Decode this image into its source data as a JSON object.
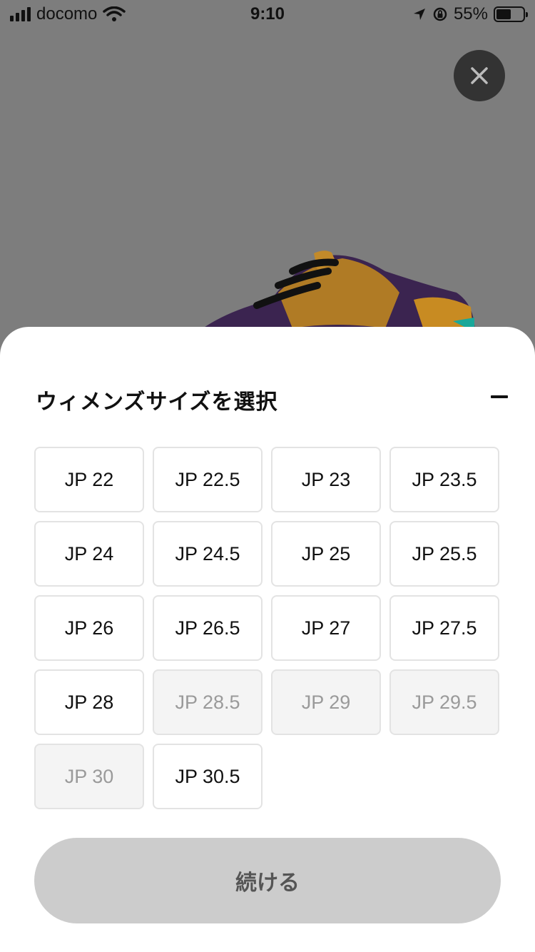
{
  "status_bar": {
    "carrier": "docomo",
    "time": "9:10",
    "battery": "55%",
    "battery_level": 0.55
  },
  "close": {
    "icon": "close-icon"
  },
  "sheet": {
    "title": "ウィメンズサイズを選択",
    "collapse_icon": "minus-icon",
    "sizes": [
      {
        "label": "JP 22",
        "available": true
      },
      {
        "label": "JP 22.5",
        "available": true
      },
      {
        "label": "JP 23",
        "available": true
      },
      {
        "label": "JP 23.5",
        "available": true
      },
      {
        "label": "JP 24",
        "available": true
      },
      {
        "label": "JP 24.5",
        "available": true
      },
      {
        "label": "JP 25",
        "available": true
      },
      {
        "label": "JP 25.5",
        "available": true
      },
      {
        "label": "JP 26",
        "available": true
      },
      {
        "label": "JP 26.5",
        "available": true
      },
      {
        "label": "JP 27",
        "available": true
      },
      {
        "label": "JP 27.5",
        "available": true
      },
      {
        "label": "JP 28",
        "available": true
      },
      {
        "label": "JP 28.5",
        "available": false
      },
      {
        "label": "JP 29",
        "available": false
      },
      {
        "label": "JP 29.5",
        "available": false
      },
      {
        "label": "JP 30",
        "available": false
      },
      {
        "label": "JP 30.5",
        "available": true
      }
    ],
    "continue_label": "続ける"
  }
}
